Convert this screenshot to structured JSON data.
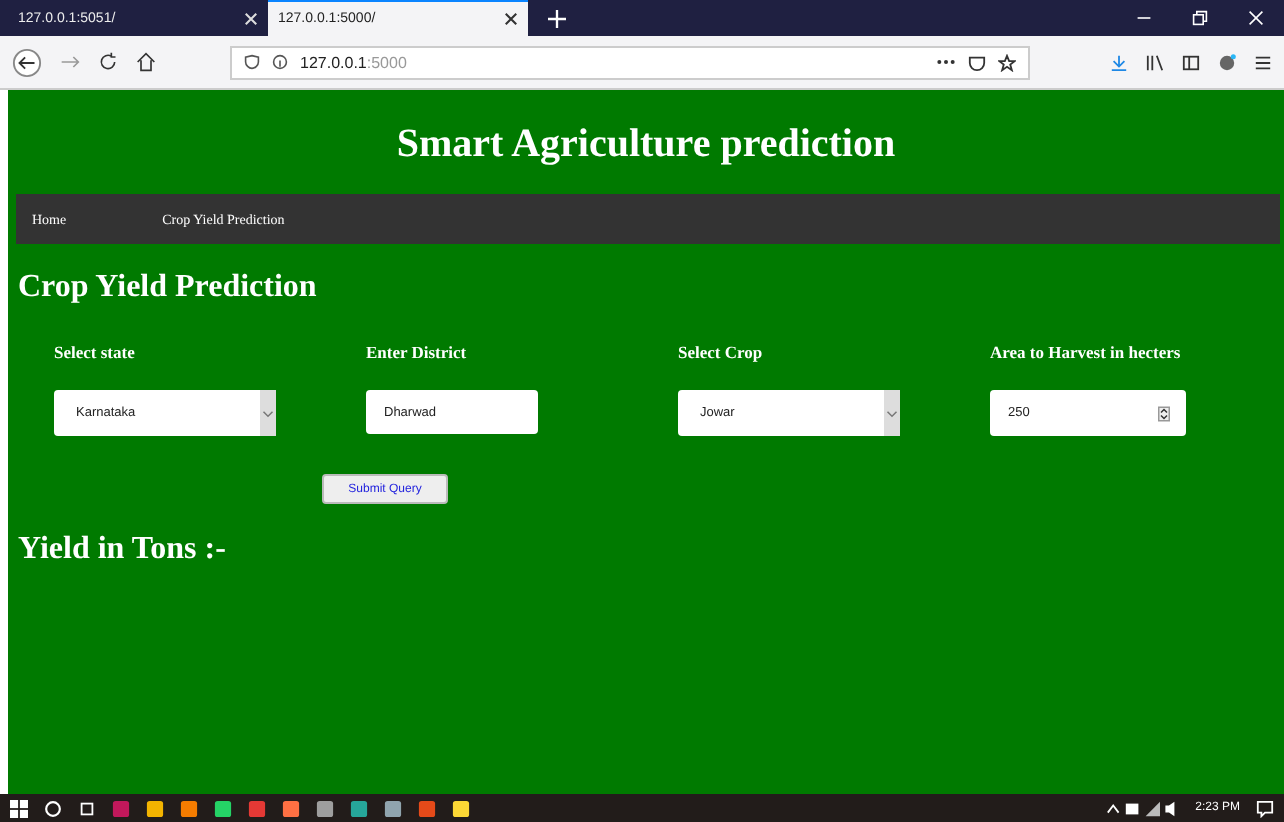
{
  "browser": {
    "tabs": [
      {
        "title": "127.0.0.1:5051/",
        "selected": false
      },
      {
        "title": "127.0.0.1:5000/",
        "selected": true
      }
    ],
    "url_host": "127.0.0.1",
    "url_port": ":5000"
  },
  "page": {
    "title": "Smart Agriculture prediction",
    "nav": [
      {
        "label": "Home"
      },
      {
        "label": "Crop Yield Prediction"
      }
    ],
    "heading": "Crop Yield Prediction",
    "fields": [
      {
        "kind": "select",
        "label": "Select state",
        "value": "Karnataka"
      },
      {
        "kind": "text",
        "label": "Enter District",
        "value": "Dharwad"
      },
      {
        "kind": "select",
        "label": "Select Crop",
        "value": "Jowar"
      },
      {
        "kind": "number",
        "label": "Area to Harvest in hecters",
        "value": "250"
      }
    ],
    "submit": "Submit Query",
    "result_label": "Yield in Tons :-"
  },
  "taskbar": {
    "time": "2:23 PM"
  }
}
